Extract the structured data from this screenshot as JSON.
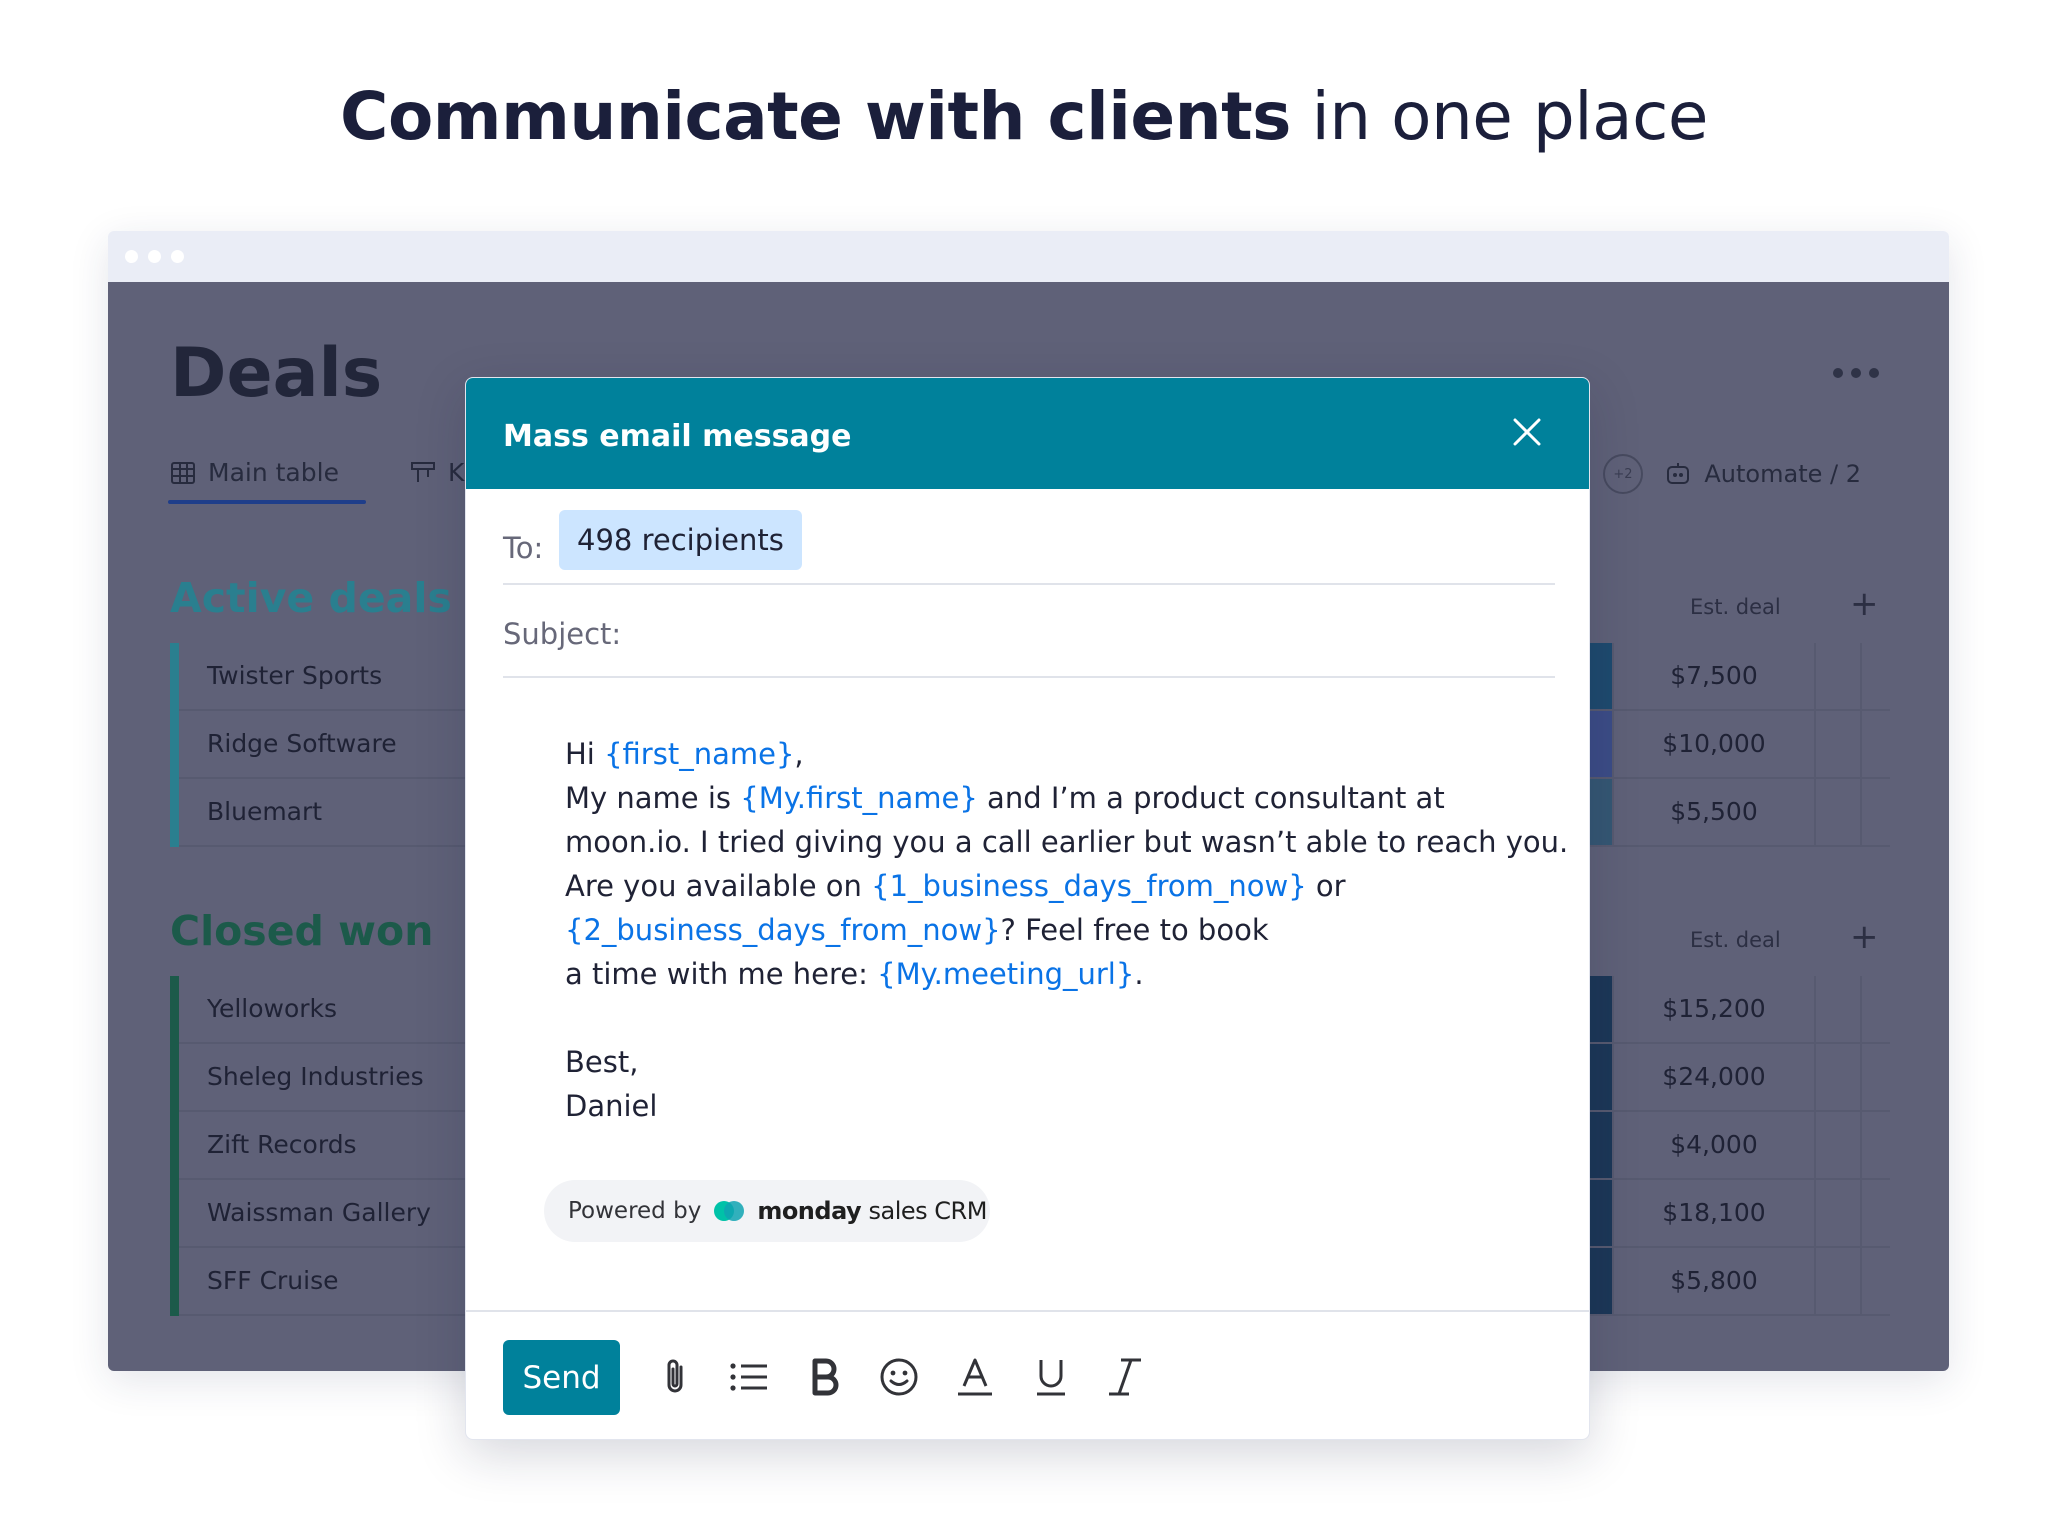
{
  "headline": {
    "bold": "Communicate with clients",
    "light": "in one place"
  },
  "board": {
    "title": "Deals",
    "tabs": {
      "main": "Main table",
      "second_partial": "K"
    },
    "avatar_overflow": "+2",
    "automate": "Automate / 2",
    "groups": [
      {
        "title": "Active deals",
        "color": "#2a7f8f",
        "column_header": "Est. deal",
        "rows": [
          {
            "name": "Twister Sports",
            "value": "$7,500",
            "status_color": "#1e4a6e"
          },
          {
            "name": "Ridge Software",
            "value": "$10,000",
            "status_color": "#3c4c86"
          },
          {
            "name": "Bluemart",
            "value": "$5,500",
            "status_color": "#355773"
          }
        ]
      },
      {
        "title": "Closed won",
        "color": "#1c5a4a",
        "column_header": "Est. deal",
        "rows": [
          {
            "name": "Yelloworks",
            "value": "$15,200",
            "status_color": "#1c3757"
          },
          {
            "name": "Sheleg Industries",
            "value": "$24,000",
            "status_color": "#1c3757"
          },
          {
            "name": "Zift Records",
            "value": "$4,000",
            "status_color": "#1c3757"
          },
          {
            "name": "Waissman Gallery",
            "value": "$18,100",
            "status_color": "#1c3757"
          },
          {
            "name": "SFF Cruise",
            "value": "$5,800",
            "status_color": "#1c3757"
          }
        ]
      }
    ]
  },
  "modal": {
    "title": "Mass email message",
    "to_label": "To:",
    "recipients": "498 recipients",
    "subject_label": "Subject:",
    "body": {
      "l1_a": "Hi ",
      "l1_var": "{first_name}",
      "l1_b": ",",
      "l2_a": "My name is ",
      "l2_var": "{My.first_name}",
      "l2_b": " and I’m a product consultant at",
      "l3": "moon.io. I tried giving you a call earlier but wasn’t able to reach you.",
      "l4_a": "Are you available on ",
      "l4_var": "{1_business_days_from_now}",
      "l4_b": " or",
      "l5_var": "{2_business_days_from_now}",
      "l5_b": "? Feel free to book",
      "l6_a": "a time with me here: ",
      "l6_var": "{My.meeting_url}",
      "l6_b": ".",
      "signoff": "Best,",
      "signature": "Daniel"
    },
    "powered": {
      "label": "Powered by",
      "brand": "monday",
      "brand_rest": "sales CRM"
    },
    "send_label": "Send",
    "toolbar_icons": [
      "attachment-icon",
      "bulleted-list-icon",
      "bold-icon",
      "emoji-icon",
      "text-color-icon",
      "underline-icon",
      "italic-icon"
    ]
  },
  "colors": {
    "accent": "#00819b",
    "overlay": "#5f6178",
    "variable": "#0a73e6",
    "recipient_chip": "#cce5ff"
  }
}
